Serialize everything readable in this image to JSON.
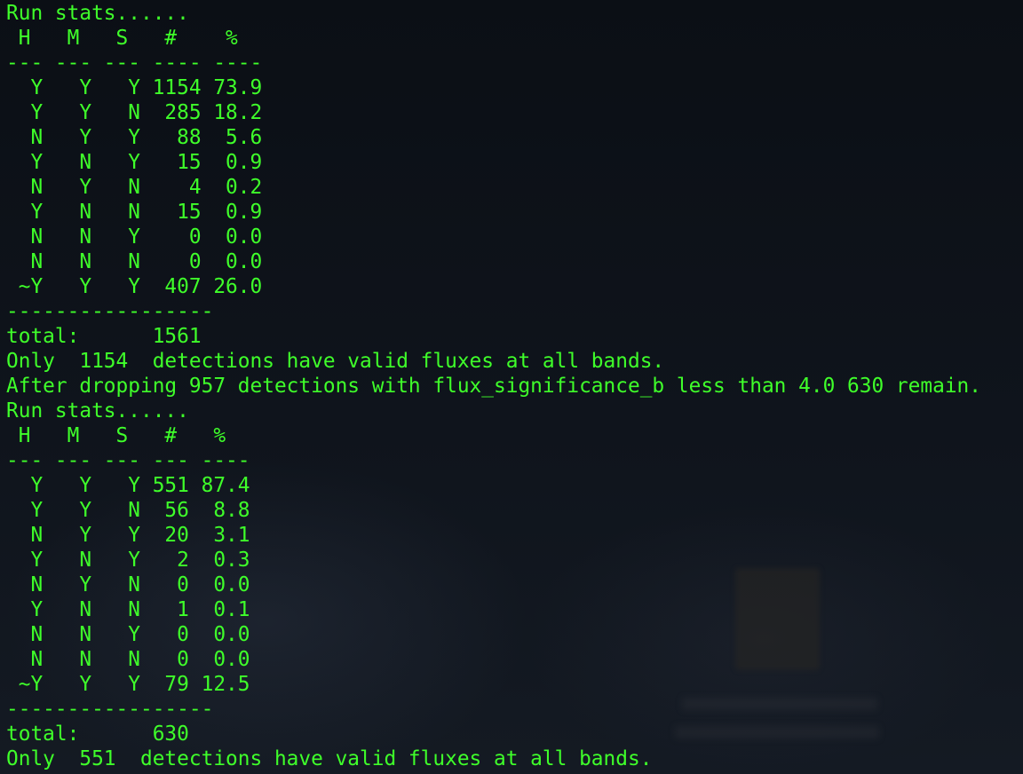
{
  "terminal": {
    "text_color": "#3fff2a",
    "background_color": "#0f141c",
    "lines": [
      "Run stats......",
      " H   M   S   #    %",
      "--- --- --- ---- ----",
      "  Y   Y   Y 1154 73.9",
      "  Y   Y   N  285 18.2",
      "  N   Y   Y   88  5.6",
      "  Y   N   Y   15  0.9",
      "  N   Y   N    4  0.2",
      "  Y   N   N   15  0.9",
      "  N   N   Y    0  0.0",
      "  N   N   N    0  0.0",
      " ~Y   Y   Y  407 26.0",
      "-----------------",
      "total:      1561",
      "Only  1154  detections have valid fluxes at all bands.",
      "After dropping 957 detections with flux_significance_b less than 4.0 630 remain.",
      "Run stats......",
      " H   M   S   #   %",
      "--- --- --- --- ----",
      "  Y   Y   Y 551 87.4",
      "  Y   Y   N  56  8.8",
      "  N   Y   Y  20  3.1",
      "  Y   N   Y   2  0.3",
      "  N   Y   N   0  0.0",
      "  Y   N   N   1  0.1",
      "  N   N   Y   0  0.0",
      "  N   N   N   0  0.0",
      " ~Y   Y   Y  79 12.5",
      "-----------------",
      "total:      630",
      "Only  551  detections have valid fluxes at all bands."
    ]
  }
}
